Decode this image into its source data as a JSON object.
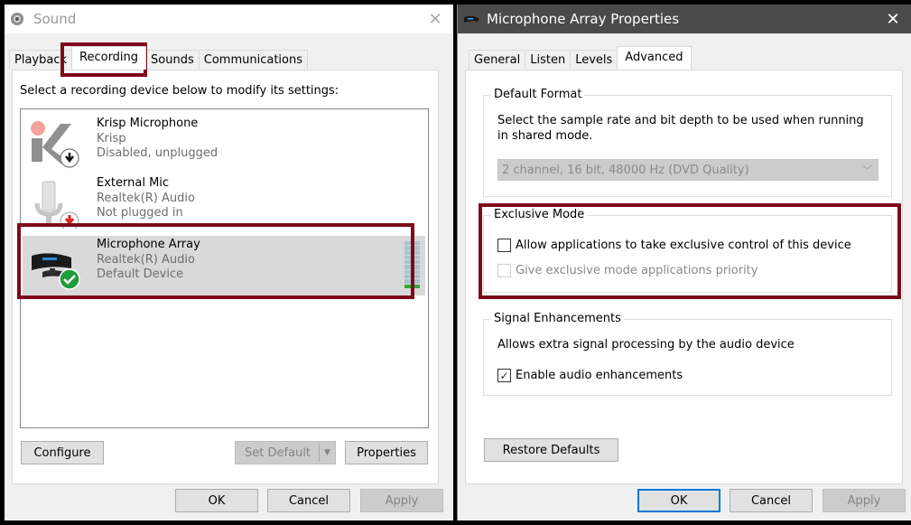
{
  "sound_dialog": {
    "title": "Sound",
    "tabs": [
      "Playback",
      "Recording",
      "Sounds",
      "Communications"
    ],
    "active_tab": "Recording",
    "instruction": "Select a recording device below to modify its settings:",
    "devices": [
      {
        "name": "Krisp Microphone",
        "driver": "Krisp",
        "status": "Disabled, unplugged",
        "icon": "krisp-icon",
        "badge": "down-arrow"
      },
      {
        "name": "External Mic",
        "driver": "Realtek(R) Audio",
        "status": "Not plugged in",
        "icon": "microphone-icon",
        "badge": "red-down-arrow"
      },
      {
        "name": "Microphone Array",
        "driver": "Realtek(R) Audio",
        "status": "Default Device",
        "icon": "webcam-mic-icon",
        "badge": "green-check",
        "selected": true,
        "level_fraction": 0.1
      }
    ],
    "buttons": {
      "configure": "Configure",
      "set_default": "Set Default",
      "properties": "Properties",
      "ok": "OK",
      "cancel": "Cancel",
      "apply": "Apply"
    }
  },
  "properties_dialog": {
    "title": "Microphone Array Properties",
    "tabs": [
      "General",
      "Listen",
      "Levels",
      "Advanced"
    ],
    "active_tab": "Advanced",
    "default_format": {
      "label": "Default Format",
      "description": "Select the sample rate and bit depth to be used when running in shared mode.",
      "selected": "2 channel, 16 bit, 48000 Hz (DVD Quality)"
    },
    "exclusive_mode": {
      "label": "Exclusive Mode",
      "allow_exclusive": {
        "label": "Allow applications to take exclusive control of this device",
        "checked": false
      },
      "give_priority": {
        "label": "Give exclusive mode applications priority",
        "checked": false,
        "disabled": true
      }
    },
    "signal_enhancements": {
      "label": "Signal Enhancements",
      "description": "Allows extra signal processing by the audio device",
      "enable": {
        "label": "Enable audio enhancements",
        "checked": true
      }
    },
    "buttons": {
      "restore_defaults": "Restore Defaults",
      "ok": "OK",
      "cancel": "Cancel",
      "apply": "Apply"
    }
  },
  "colors": {
    "highlight_box": "#7d0a1a",
    "selected_row": "#d9d9d9",
    "level_on": "#2eaa3a",
    "level_off": "#a9c4cc",
    "focus_blue": "#0078d7"
  }
}
